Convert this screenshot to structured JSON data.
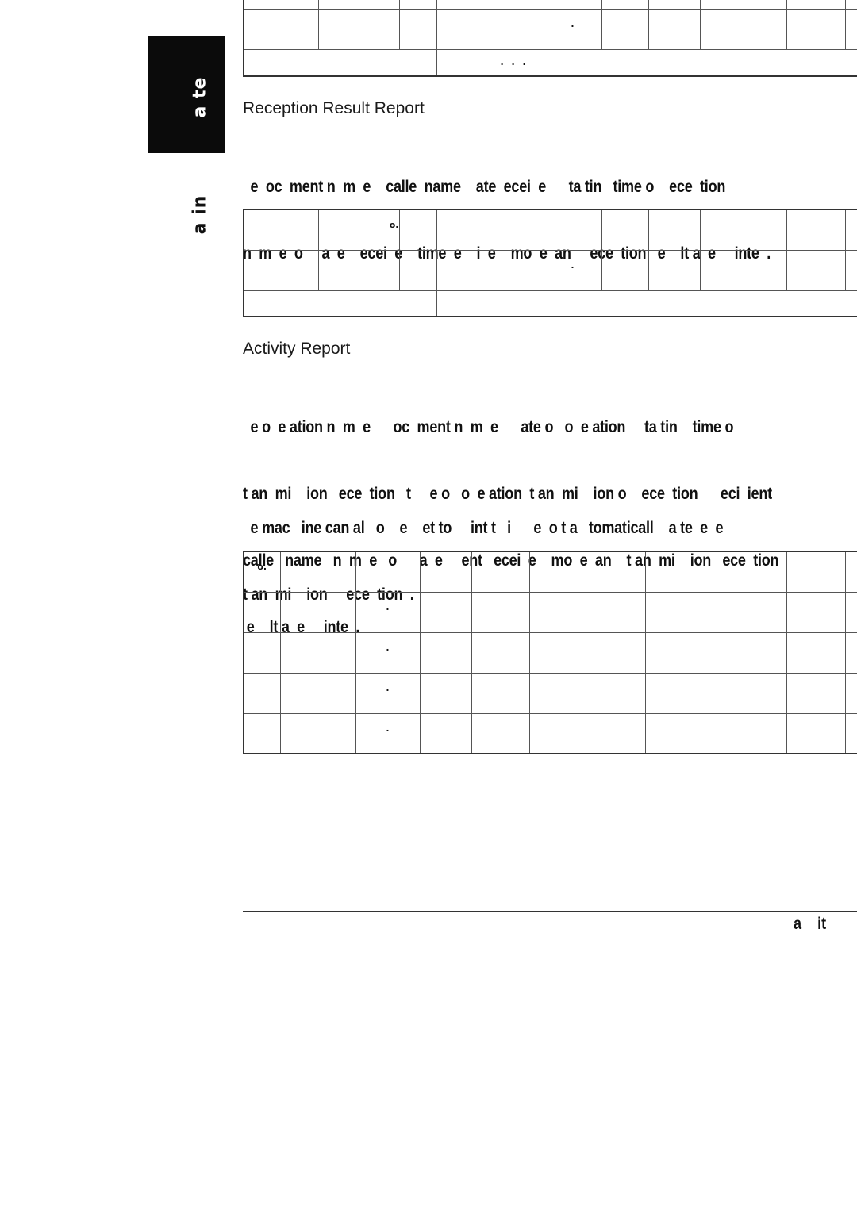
{
  "side_tab": {
    "label": "a te"
  },
  "side_label": {
    "label": "a in"
  },
  "top_table": {
    "rows": [
      [
        "",
        "",
        "",
        "",
        "",
        "",
        "",
        "",
        "",
        ""
      ],
      [
        "",
        "",
        "",
        "",
        ".",
        "",
        "",
        "",
        "",
        ""
      ]
    ],
    "footer_left": "",
    "footer_right": ". . ."
  },
  "reception_result": {
    "heading": "Reception Result Report",
    "paragraph_lines": [
      "  e  oc  ment n  m  e    calle  name    ate  ecei  e      ta tin   time o    ece  tion",
      "n  m  e  o     a  e    ecei  e    time  e    i  e    mo  e  an     ece  tion   e    lt a  e     inte  ."
    ],
    "table": {
      "rows": [
        [
          "",
          "o.",
          "",
          "",
          "",
          "",
          "",
          "",
          "",
          ""
        ],
        [
          "",
          "",
          "",
          "",
          ".",
          "",
          "",
          "",
          "",
          ""
        ]
      ],
      "footer_left": "",
      "footer_right": ""
    }
  },
  "activity": {
    "heading": "Activity Report",
    "paragraph1_lines": [
      "  e o  e ation n  m  e      oc  ment n  m  e      ate o   o  e ation     ta tin    time o",
      "t an  mi    ion   ece  tion   t     e o   o  e ation  t an  mi    ion o    ece  tion      eci  ient",
      "calle   name   n  m  e   o      a  e     ent   ecei  e    mo  e  an    t an  mi    ion   ece  tion",
      " e    lt a  e     inte  ."
    ],
    "paragraph2_lines": [
      "  e mac   ine can al   o    e    et to     int t   i      e  o t a   tomaticall    a te  e  e",
      "t an  mi    ion     ece  tion  ."
    ],
    "table": {
      "rows": [
        [
          "o.",
          "",
          "",
          "",
          "",
          "",
          "",
          "",
          "",
          ""
        ],
        [
          "",
          "",
          ".",
          "",
          "",
          "",
          "",
          "",
          "",
          ""
        ],
        [
          "",
          "",
          ".",
          "",
          "",
          "",
          "",
          "",
          "",
          ""
        ],
        [
          "",
          "",
          ".",
          "",
          "",
          "",
          "",
          "",
          "",
          ""
        ],
        [
          "",
          "",
          ".",
          "",
          "",
          "",
          "",
          "",
          "",
          ""
        ]
      ]
    }
  },
  "footer": {
    "text": "a    it"
  }
}
